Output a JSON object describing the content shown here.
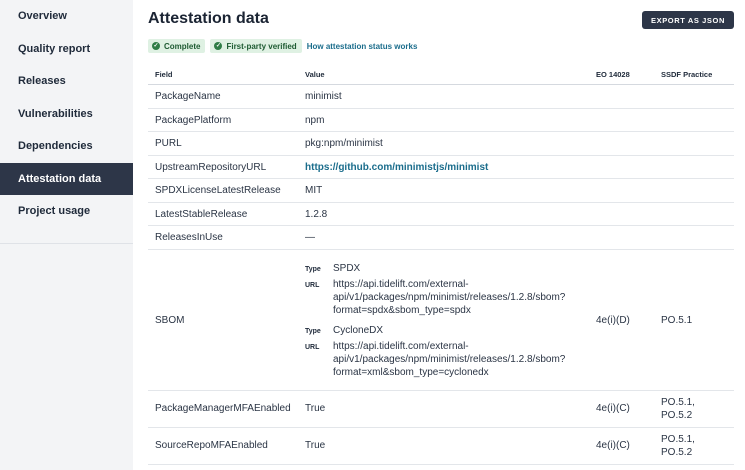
{
  "sidebar": {
    "items": [
      {
        "label": "Overview"
      },
      {
        "label": "Quality report"
      },
      {
        "label": "Releases"
      },
      {
        "label": "Vulnerabilities"
      },
      {
        "label": "Dependencies"
      },
      {
        "label": "Attestation data",
        "active": true
      },
      {
        "label": "Project usage"
      }
    ]
  },
  "header": {
    "title": "Attestation data",
    "export_label": "EXPORT AS JSON"
  },
  "badges": {
    "complete": "Complete",
    "first_party": "First-party verified",
    "how_link": "How attestation status works"
  },
  "table": {
    "headers": {
      "field": "Field",
      "value": "Value",
      "eo": "EO 14028",
      "ssdf": "SSDF Practice"
    },
    "rows": [
      {
        "field": "PackageName",
        "value": "minimist"
      },
      {
        "field": "PackagePlatform",
        "value": "npm"
      },
      {
        "field": "PURL",
        "value": "pkg:npm/minimist"
      },
      {
        "field": "UpstreamRepositoryURL",
        "value": "https://github.com/minimistjs/minimist"
      },
      {
        "field": "SPDXLicenseLatestRelease",
        "value": "MIT"
      },
      {
        "field": "LatestStableRelease",
        "value": "1.2.8"
      },
      {
        "field": "ReleasesInUse",
        "value": "—"
      }
    ],
    "sbom": {
      "field": "SBOM",
      "eo": "4e(i)(D)",
      "ssdf": "PO.5.1",
      "type_label": "Type",
      "url_label": "URL",
      "entries": [
        {
          "type": "SPDX",
          "url_lines": [
            "https://api.tidelift.com/external-",
            "api/v1/packages/npm/minimist/releases/1.2.8/sbom?",
            "format=spdx&sbom_type=spdx"
          ]
        },
        {
          "type": "CycloneDX",
          "url_lines": [
            "https://api.tidelift.com/external-",
            "api/v1/packages/npm/minimist/releases/1.2.8/sbom?",
            "format=xml&sbom_type=cyclonedx"
          ]
        }
      ]
    },
    "mfa_rows": [
      {
        "field": "PackageManagerMFAEnabled",
        "value": "True",
        "eo": "4e(i)(C)",
        "ssdf_1": "PO.5.1,",
        "ssdf_2": "PO.5.2"
      },
      {
        "field": "SourceRepoMFAEnabled",
        "value": "True",
        "eo": "4e(i)(C)",
        "ssdf_1": "PO.5.1,",
        "ssdf_2": "PO.5.2"
      }
    ]
  }
}
